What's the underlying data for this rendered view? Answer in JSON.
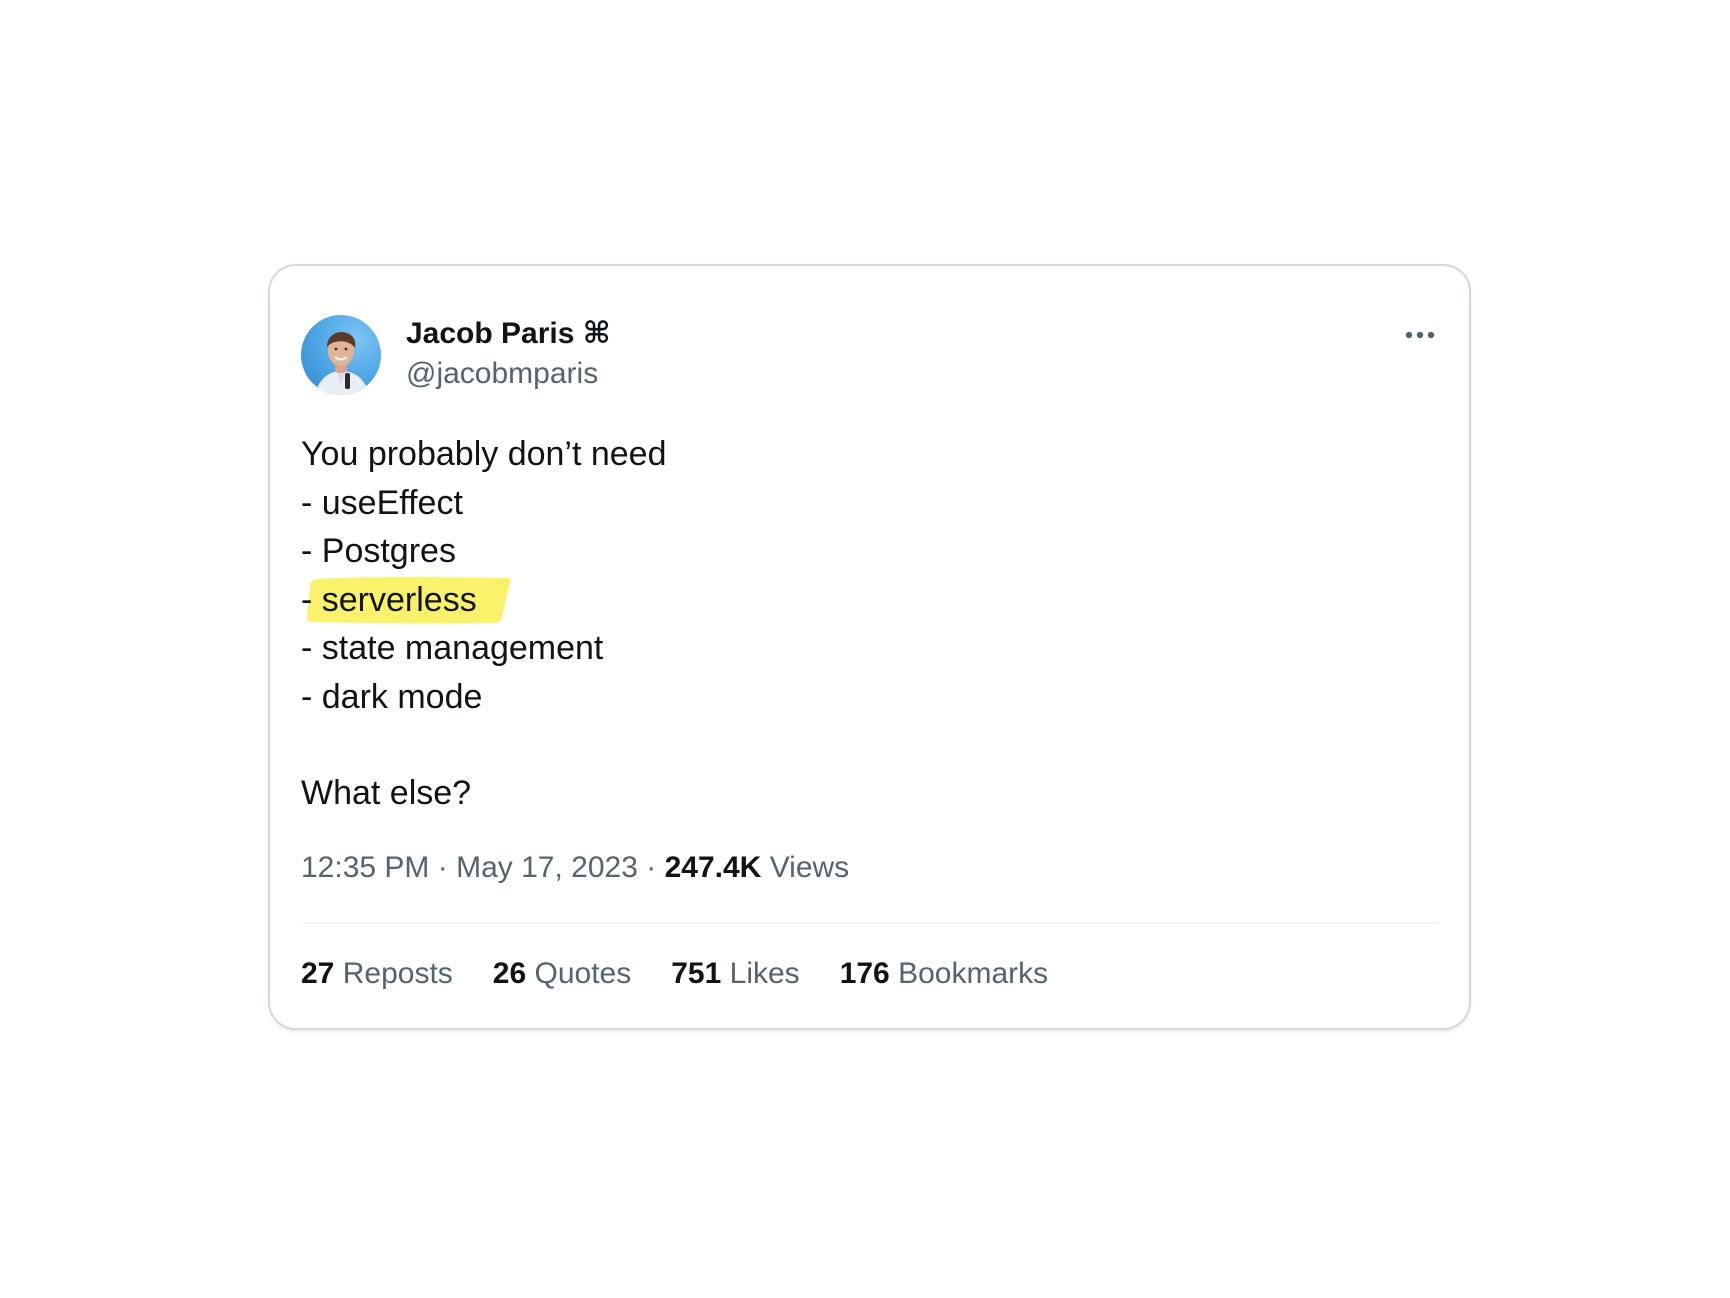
{
  "tweet": {
    "author": {
      "display_name": "Jacob Paris ⌘",
      "handle": "@jacobmparis"
    },
    "text_lines": [
      "You probably don’t need",
      "- useEffect",
      "- Postgres",
      "- serverless",
      "- state management",
      "- dark mode",
      "",
      "What else?"
    ],
    "highlighted_line_index": 3,
    "highlight_color": "#fbf26b",
    "meta": {
      "time": "12:35 PM",
      "separator": "·",
      "date": "May 17, 2023",
      "views_count": "247.4K",
      "views_label": "Views"
    },
    "stats": [
      {
        "count": "27",
        "label": "Reposts"
      },
      {
        "count": "26",
        "label": "Quotes"
      },
      {
        "count": "751",
        "label": "Likes"
      },
      {
        "count": "176",
        "label": "Bookmarks"
      }
    ],
    "icons": {
      "more": "more-horizontal-icon",
      "avatar": "profile-photo"
    },
    "colors": {
      "text_primary": "#0f1419",
      "text_secondary": "#536471",
      "border": "#cfd9de"
    }
  }
}
